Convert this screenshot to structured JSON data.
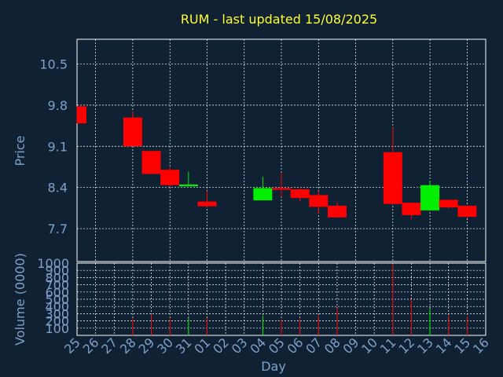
{
  "chart_data": [
    {
      "type": "candlestick",
      "title": "RUM - last updated 15/08/2025",
      "ylabel": "Price",
      "ylim": [
        7.14,
        10.92
      ],
      "yticks": [
        "7.7",
        "8.4",
        "9.1",
        "9.8",
        "10.5"
      ],
      "grid": true,
      "days": [
        "25",
        "26",
        "27",
        "28",
        "29",
        "30",
        "31",
        "01",
        "02",
        "03",
        "04",
        "05",
        "06",
        "07",
        "08",
        "09",
        "10",
        "11",
        "12",
        "13",
        "14",
        "15",
        "16"
      ],
      "candles": [
        {
          "day": "25",
          "open": 9.78,
          "close": 9.49,
          "high": 9.78,
          "low": 9.49
        },
        {
          "day": "28",
          "open": 9.59,
          "close": 9.1,
          "high": 9.69,
          "low": 9.1
        },
        {
          "day": "29",
          "open": 9.02,
          "close": 8.63,
          "high": 9.02,
          "low": 8.63
        },
        {
          "day": "30",
          "open": 8.7,
          "close": 8.44,
          "high": 8.76,
          "low": 8.4
        },
        {
          "day": "31",
          "open": 8.42,
          "close": 8.45,
          "high": 8.67,
          "low": 8.42
        },
        {
          "day": "01",
          "open": 8.16,
          "close": 8.08,
          "high": 8.34,
          "low": 8.06
        },
        {
          "day": "04",
          "open": 8.18,
          "close": 8.39,
          "high": 8.58,
          "low": 8.18
        },
        {
          "day": "05",
          "open": 8.39,
          "close": 8.36,
          "high": 8.64,
          "low": 8.24
        },
        {
          "day": "06",
          "open": 8.37,
          "close": 8.22,
          "high": 8.38,
          "low": 8.16
        },
        {
          "day": "07",
          "open": 8.27,
          "close": 8.07,
          "high": 8.34,
          "low": 7.96
        },
        {
          "day": "08",
          "open": 8.09,
          "close": 7.89,
          "high": 8.15,
          "low": 7.89
        },
        {
          "day": "11",
          "open": 9.0,
          "close": 8.12,
          "high": 9.42,
          "low": 8.12
        },
        {
          "day": "12",
          "open": 8.14,
          "close": 7.93,
          "high": 8.14,
          "low": 7.86
        },
        {
          "day": "13",
          "open": 8.01,
          "close": 8.44,
          "high": 8.51,
          "low": 8.01
        },
        {
          "day": "14",
          "open": 8.19,
          "close": 8.06,
          "high": 8.2,
          "low": 8.04
        },
        {
          "day": "15",
          "open": 8.09,
          "close": 7.9,
          "high": 8.09,
          "low": 7.88
        }
      ]
    },
    {
      "type": "bar",
      "ylabel": "Volume (0000)",
      "xlabel": "Day",
      "ylim": [
        0,
        1000
      ],
      "yticks": [
        "100",
        "200",
        "300",
        "400",
        "500",
        "600",
        "700",
        "800",
        "900",
        "1000"
      ],
      "grid": true,
      "bars": [
        {
          "day": "28",
          "value": 230,
          "color": "red"
        },
        {
          "day": "29",
          "value": 290,
          "color": "red"
        },
        {
          "day": "30",
          "value": 230,
          "color": "red"
        },
        {
          "day": "31",
          "value": 240,
          "color": "green"
        },
        {
          "day": "01",
          "value": 240,
          "color": "red"
        },
        {
          "day": "04",
          "value": 270,
          "color": "green"
        },
        {
          "day": "05",
          "value": 220,
          "color": "red"
        },
        {
          "day": "06",
          "value": 230,
          "color": "red"
        },
        {
          "day": "07",
          "value": 270,
          "color": "red"
        },
        {
          "day": "08",
          "value": 380,
          "color": "red"
        },
        {
          "day": "11",
          "value": 990,
          "color": "red"
        },
        {
          "day": "12",
          "value": 500,
          "color": "red"
        },
        {
          "day": "13",
          "value": 370,
          "color": "green"
        },
        {
          "day": "14",
          "value": 270,
          "color": "red"
        },
        {
          "day": "15",
          "value": 260,
          "color": "red"
        }
      ]
    }
  ],
  "colors": {
    "background": "#0f2133",
    "title": "#ffff33",
    "axis_text": "#7fa0c8",
    "grid": "#ffffff",
    "up": "#00ee00",
    "down": "#ff0000"
  }
}
